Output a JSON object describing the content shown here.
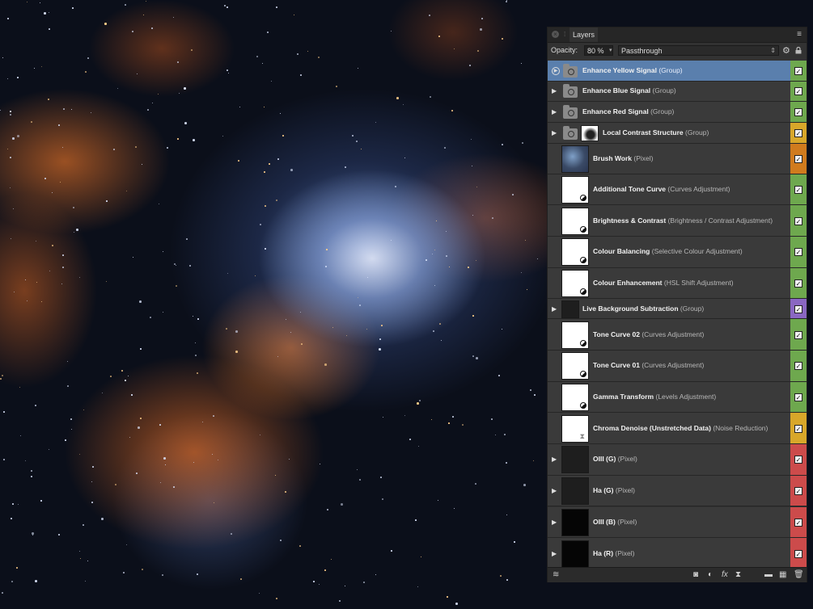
{
  "panel": {
    "tab_label": "Layers",
    "opacity_label": "Opacity:",
    "opacity_value": "80 %",
    "blend_mode": "Passthrough"
  },
  "tag_colors": {
    "green": "#6ea84e",
    "yellow": "#d8a72a",
    "orange": "#d07b1e",
    "purple": "#8a67c2",
    "red": "#cc4b4b"
  },
  "layers": [
    {
      "name": "Enhance Yellow Signal",
      "type": "(Group)",
      "kind": "group",
      "tag": "green",
      "checked": true,
      "selected": true
    },
    {
      "name": "Enhance Blue Signal",
      "type": "(Group)",
      "kind": "group",
      "tag": "green",
      "checked": true
    },
    {
      "name": "Enhance Red Signal",
      "type": "(Group)",
      "kind": "group",
      "tag": "green",
      "checked": true
    },
    {
      "name": "Local Contrast Structure",
      "type": "(Group)",
      "kind": "group-mask",
      "tag": "yellow",
      "checked": true
    },
    {
      "name": "Brush Work",
      "type": "(Pixel)",
      "kind": "pixel-brush",
      "tag": "orange",
      "checked": true
    },
    {
      "name": "Additional Tone Curve",
      "type": "(Curves Adjustment)",
      "kind": "adjustment",
      "tag": "green",
      "checked": true
    },
    {
      "name": "Brightness & Contrast",
      "type": "(Brightness / Contrast Adjustment)",
      "kind": "adjustment",
      "tag": "green",
      "checked": true
    },
    {
      "name": "Colour Balancing",
      "type": "(Selective Colour Adjustment)",
      "kind": "adjustment",
      "tag": "green",
      "checked": true
    },
    {
      "name": "Colour Enhancement",
      "type": "(HSL Shift Adjustment)",
      "kind": "adjustment",
      "tag": "green",
      "checked": true
    },
    {
      "name": "Live Background Subtraction",
      "type": "(Group)",
      "kind": "group-plain",
      "tag": "purple",
      "checked": true
    },
    {
      "name": "Tone Curve 02",
      "type": "(Curves Adjustment)",
      "kind": "adjustment",
      "tag": "green",
      "checked": true
    },
    {
      "name": "Tone Curve 01",
      "type": "(Curves Adjustment)",
      "kind": "adjustment",
      "tag": "green",
      "checked": true
    },
    {
      "name": "Gamma Transform",
      "type": "(Levels Adjustment)",
      "kind": "adjustment",
      "tag": "green",
      "checked": true
    },
    {
      "name": "Chroma Denoise (Unstretched Data)",
      "type": "(Noise Reduction)",
      "kind": "filter",
      "tag": "yellow",
      "checked": true
    },
    {
      "name": "OIII (G)",
      "type": "(Pixel)",
      "kind": "pixel-dark",
      "tag": "red",
      "checked": true
    },
    {
      "name": "Ha (G)",
      "type": "(Pixel)",
      "kind": "pixel-dark",
      "tag": "red",
      "checked": true
    },
    {
      "name": "OIII (B)",
      "type": "(Pixel)",
      "kind": "pixel-black",
      "tag": "red",
      "checked": true
    },
    {
      "name": "Ha (R)",
      "type": "(Pixel)",
      "kind": "pixel-black",
      "tag": "red",
      "checked": true
    }
  ],
  "icons": {
    "close": "close-icon",
    "menu": "panel-menu-icon",
    "settings": "gear-icon",
    "lock": "lock-icon",
    "footer": [
      "layers-stack-icon",
      "mask-icon",
      "adjustment-icon",
      "fx-icon",
      "live-filter-icon",
      "folder-icon",
      "pixel-layer-icon",
      "trash-icon"
    ]
  }
}
